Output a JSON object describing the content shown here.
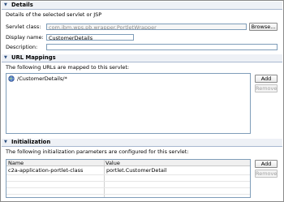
{
  "details": {
    "title": "Details",
    "description": "Details of the selected servlet or JSP",
    "servlet_class_label": "Servlet class:",
    "servlet_class_value": "com.ibm.wps.pb.wrapper.PortletWrapper",
    "browse_label": "Browse...",
    "display_name_label": "Display name:",
    "display_name_value": "CustomerDetails",
    "description_label": "Description:",
    "description_value": ""
  },
  "url_mappings": {
    "title": "URL Mappings",
    "description": "The following URLs are mapped to this servlet:",
    "items": [
      {
        "icon": "globe-url-icon",
        "label": "/CustomerDetails/*"
      }
    ],
    "add_label": "Add",
    "remove_label": "Remove"
  },
  "initialization": {
    "title": "Initialization",
    "description": "The following initialization parameters are configured for this servlet:",
    "columns": [
      "Name",
      "Value"
    ],
    "rows": [
      {
        "name": "c2a-application-portlet-class",
        "value": "portlet.CustomerDetail"
      }
    ],
    "add_label": "Add",
    "remove_label": "Remove"
  },
  "colors": {
    "header_bg": "#eef1f6",
    "accent": "#2d4f80",
    "field_border": "#7f9db9"
  }
}
